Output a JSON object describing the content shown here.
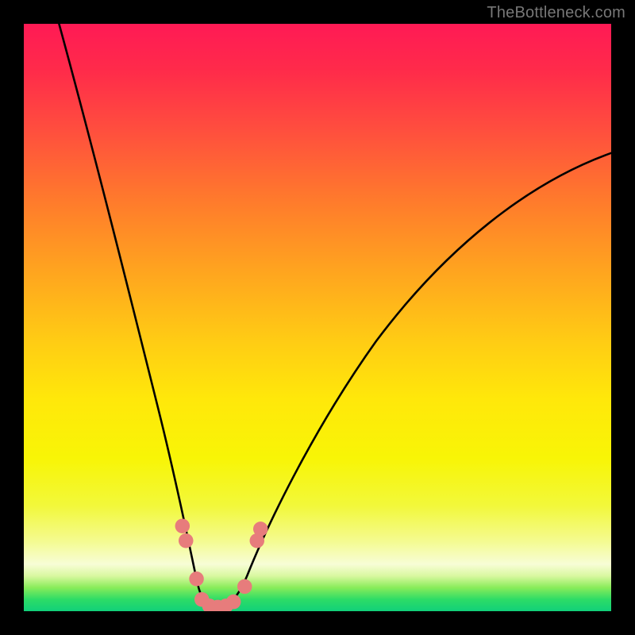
{
  "watermark": "TheBottleneck.com",
  "chart_data": {
    "type": "line",
    "title": "",
    "xlabel": "",
    "ylabel": "",
    "xlim": [
      0,
      100
    ],
    "ylim": [
      0,
      100
    ],
    "background_gradient": {
      "direction": "vertical",
      "stops": [
        {
          "pos": 0,
          "color": "#ff1a55"
        },
        {
          "pos": 50,
          "color": "#ffd400"
        },
        {
          "pos": 92,
          "color": "#f7fdd6"
        },
        {
          "pos": 100,
          "color": "#11d07a"
        }
      ]
    },
    "series": [
      {
        "name": "left-branch",
        "x": [
          6,
          10,
          14,
          18,
          22,
          25,
          27,
          29,
          30
        ],
        "y": [
          100,
          82,
          64,
          46,
          30,
          16,
          8,
          2,
          0
        ]
      },
      {
        "name": "right-branch",
        "x": [
          36,
          38,
          42,
          48,
          56,
          66,
          78,
          90,
          100
        ],
        "y": [
          0,
          2,
          8,
          18,
          32,
          48,
          62,
          72,
          78
        ]
      }
    ],
    "markers": [
      {
        "name": "left-dot-1",
        "x": 27.0,
        "y": 14.5
      },
      {
        "name": "left-dot-2",
        "x": 27.6,
        "y": 12.0
      },
      {
        "name": "left-dot-3",
        "x": 29.4,
        "y": 5.5
      },
      {
        "name": "valley-1",
        "x": 30.3,
        "y": 2.0
      },
      {
        "name": "valley-2",
        "x": 31.6,
        "y": 0.9
      },
      {
        "name": "valley-3",
        "x": 33.0,
        "y": 0.7
      },
      {
        "name": "valley-4",
        "x": 34.4,
        "y": 0.9
      },
      {
        "name": "valley-5",
        "x": 35.7,
        "y": 1.6
      },
      {
        "name": "right-dot-1",
        "x": 37.6,
        "y": 4.2
      },
      {
        "name": "right-dot-2",
        "x": 39.7,
        "y": 12.0
      },
      {
        "name": "right-dot-3",
        "x": 40.3,
        "y": 14.0
      }
    ],
    "marker_style": {
      "color": "#e77c7c",
      "radius_px": 9
    }
  }
}
